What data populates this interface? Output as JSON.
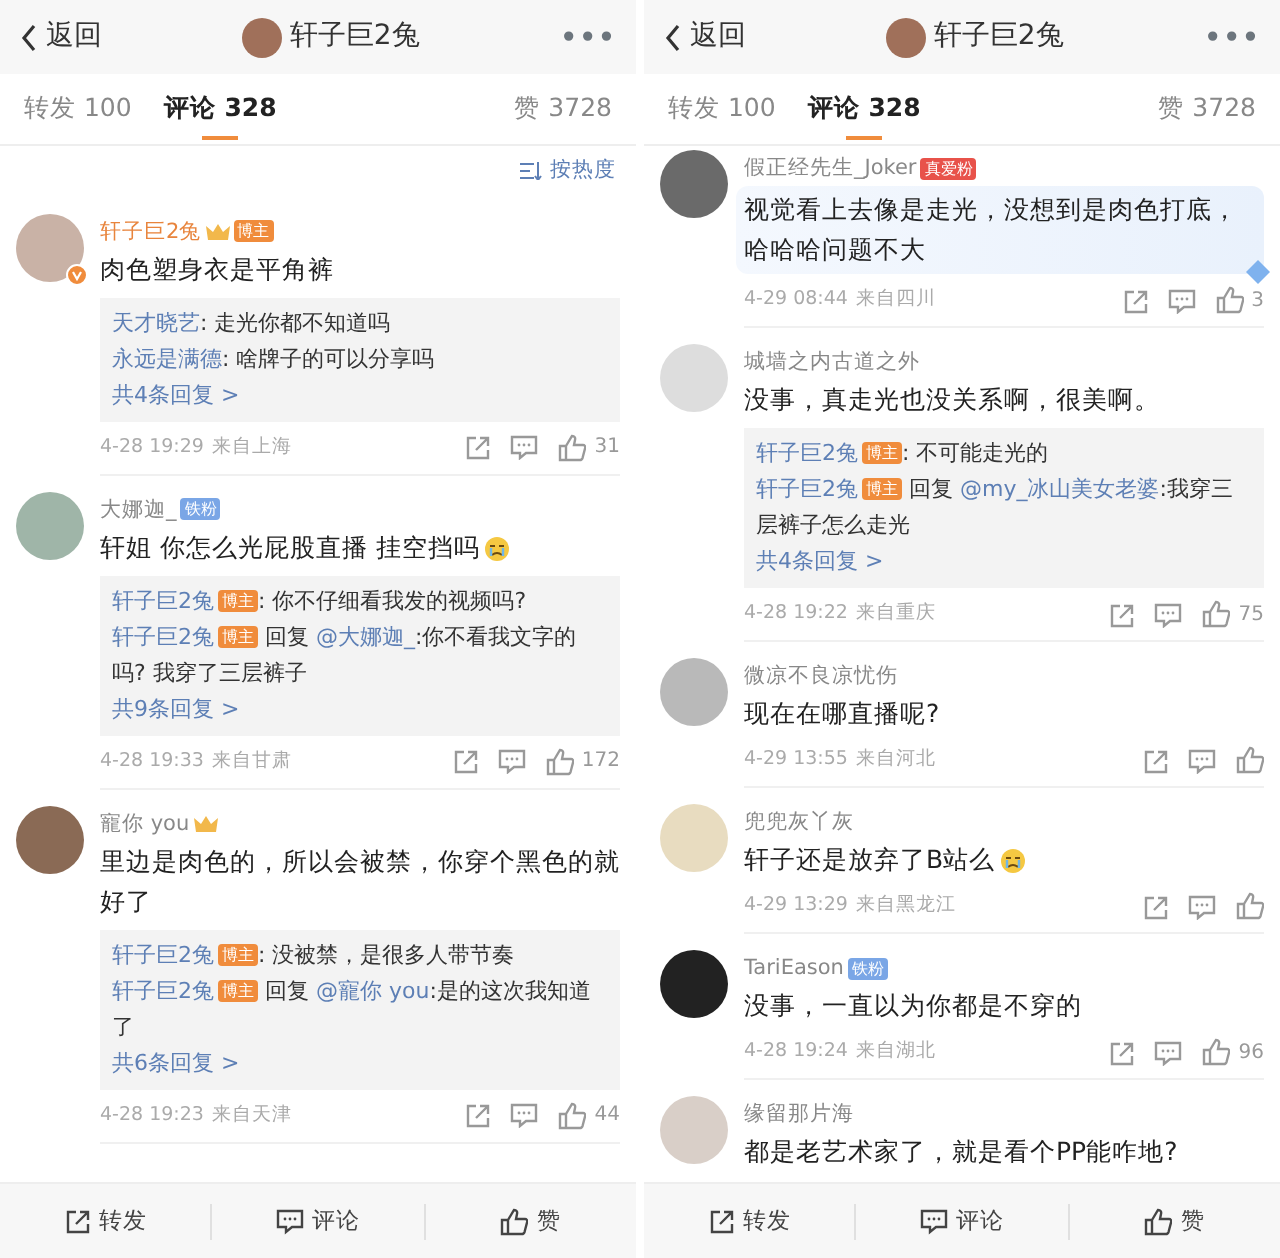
{
  "screens": [
    {
      "header": {
        "back": "返回",
        "title": "轩子巨2兔",
        "more": "•••"
      },
      "tabs": [
        {
          "label": "转发 100",
          "selected": false
        },
        {
          "label": "评论 328",
          "selected": true
        },
        {
          "label": "赞 3728",
          "selected": false
        }
      ],
      "sort": "按热度",
      "comments": [
        {
          "name": "轩子巨2兔",
          "author": true,
          "crown": true,
          "badge": {
            "text": "博主",
            "kind": "host"
          },
          "verified": true,
          "text": "肉色塑身衣是平角裤",
          "emoji": false,
          "bubble": false,
          "replies": [
            {
              "name": "天才晓艺",
              "text": ": 走光你都不知道吗"
            },
            {
              "name": "永远是满德",
              "text": ": 啥牌子的可以分享吗"
            }
          ],
          "more": "共4条回复 >",
          "time": "4-28 19:29",
          "location": "来自上海",
          "likes": "31"
        },
        {
          "name": "大娜迦_",
          "author": false,
          "crown": false,
          "badge": {
            "text": "铁粉",
            "kind": "fan"
          },
          "verified": false,
          "text": "轩姐 你怎么光屁股直播 挂空挡吗",
          "emoji": true,
          "bubble": false,
          "replies": [
            {
              "name": "轩子巨2兔",
              "badge": {
                "text": "博主",
                "kind": "host"
              },
              "text": ": 你不仔细看我发的视频吗?"
            },
            {
              "name": "轩子巨2兔",
              "badge": {
                "text": "博主",
                "kind": "host"
              },
              "prefix": "回复",
              "mention": "@大娜迦_",
              "text": ":你不看我文字的吗? 我穿了三层裤子"
            }
          ],
          "more": "共9条回复 >",
          "time": "4-28 19:33",
          "location": "来自甘肃",
          "likes": "172"
        },
        {
          "name": "寵你 you",
          "author": false,
          "crown": true,
          "verified": false,
          "text": "里边是肉色的，所以会被禁，你穿个黑色的就好了",
          "emoji": false,
          "bubble": false,
          "replies": [
            {
              "name": "轩子巨2兔",
              "badge": {
                "text": "博主",
                "kind": "host"
              },
              "text": ": 没被禁，是很多人带节奏"
            },
            {
              "name": "轩子巨2兔",
              "badge": {
                "text": "博主",
                "kind": "host"
              },
              "prefix": "回复",
              "mention": "@寵你 you",
              "text": ":是的这次我知道了"
            }
          ],
          "more": "共6条回复 >",
          "time": "4-28 19:23",
          "location": "来自天津",
          "likes": "44"
        }
      ],
      "bottom_bar": [
        "转发",
        "评论",
        "赞"
      ]
    },
    {
      "header": {
        "back": "返回",
        "title": "轩子巨2兔",
        "more": "•••"
      },
      "tabs": [
        {
          "label": "转发 100",
          "selected": false
        },
        {
          "label": "评论 328",
          "selected": true
        },
        {
          "label": "赞 3728",
          "selected": false
        }
      ],
      "comments": [
        {
          "name": "假正经先生_Joker",
          "author": false,
          "crown": false,
          "badge": {
            "text": "真爱粉",
            "kind": "love"
          },
          "verified": false,
          "text": "视觉看上去像是走光，没想到是肉色打底，哈哈哈问题不大",
          "emoji": false,
          "bubble": true,
          "time": "4-29 08:44",
          "location": "来自四川",
          "likes": "3"
        },
        {
          "name": "城墙之内古道之外",
          "author": false,
          "crown": false,
          "verified": false,
          "text": "没事，真走光也没关系啊，很美啊。",
          "emoji": false,
          "bubble": false,
          "replies": [
            {
              "name": "轩子巨2兔",
              "badge": {
                "text": "博主",
                "kind": "host"
              },
              "text": ": 不可能走光的"
            },
            {
              "name": "轩子巨2兔",
              "badge": {
                "text": "博主",
                "kind": "host"
              },
              "prefix": "回复",
              "mention": "@my_冰山美女老婆",
              "text": ":我穿三层裤子怎么走光"
            }
          ],
          "more": "共4条回复 >",
          "time": "4-28 19:22",
          "location": "来自重庆",
          "likes": "75"
        },
        {
          "name": "微凉不良凉忧伤",
          "author": false,
          "crown": false,
          "verified": false,
          "text": "现在在哪直播呢?",
          "emoji": false,
          "bubble": false,
          "time": "4-29 13:55",
          "location": "来自河北"
        },
        {
          "name": "兜兜灰丫灰",
          "author": false,
          "crown": false,
          "verified": false,
          "text": "轩子还是放弃了B站么",
          "emoji": true,
          "bubble": false,
          "time": "4-29 13:29",
          "location": "来自黑龙江"
        },
        {
          "name": "TariEason",
          "author": false,
          "crown": false,
          "badge": {
            "text": "铁粉",
            "kind": "fan"
          },
          "verified": false,
          "text": "没事，一直以为你都是不穿的",
          "emoji": false,
          "bubble": false,
          "time": "4-28 19:24",
          "location": "来自湖北",
          "likes": "96"
        },
        {
          "name": "缘留那片海",
          "author": false,
          "crown": false,
          "verified": false,
          "text": "都是老艺术家了，就是看个PP能咋地?",
          "emoji": false,
          "bubble": false
        }
      ],
      "bottom_bar": [
        "转发",
        "评论",
        "赞"
      ]
    }
  ]
}
